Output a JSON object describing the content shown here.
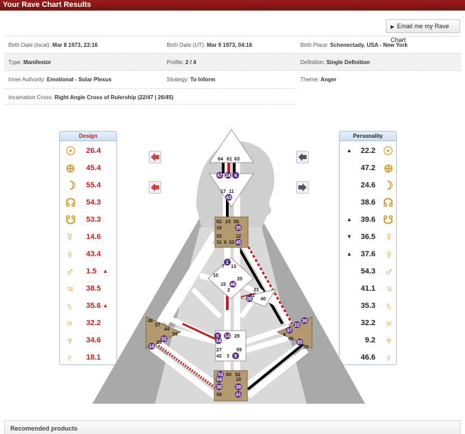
{
  "title_bar": "Your Rave Chart Results",
  "email_button": "Email me my Rave Chart",
  "info": {
    "birth_date_local_label": "Birth Date (local):",
    "birth_date_local": "Mar 8 1973, 23:16",
    "birth_date_utc_label": "Birth Date (UT):",
    "birth_date_utc": "Mar 9 1973, 04:16",
    "birth_place_label": "Birth Place:",
    "birth_place": "Schenectady, USA - New York",
    "type_label": "Type:",
    "type": "Manifestor",
    "profile_label": "Profile:",
    "profile": "2 / 4",
    "definition_label": "Definition:",
    "definition": "Single Definition",
    "authority_label": "Inner Authority:",
    "authority": "Emotional - Solar Plexus",
    "strategy_label": "Strategy:",
    "strategy": "To Inform",
    "theme_label": "Theme:",
    "theme": "Anger",
    "cross_label": "Incarnation Cross:",
    "cross": "Right Angle Cross of Rulership (22/47 | 26/45)"
  },
  "design": {
    "header": "Design",
    "rows": [
      {
        "icon": "sun-icon",
        "glyph": "☉",
        "value": "26.4",
        "mark": ""
      },
      {
        "icon": "earth-icon",
        "glyph": "⊕",
        "value": "45.4",
        "mark": ""
      },
      {
        "icon": "moon-icon",
        "glyph": "☽",
        "value": "55.4",
        "mark": ""
      },
      {
        "icon": "north-node-icon",
        "glyph": "☊",
        "value": "54.3",
        "mark": ""
      },
      {
        "icon": "south-node-icon",
        "glyph": "☋",
        "value": "53.3",
        "mark": ""
      },
      {
        "icon": "mercury-icon",
        "glyph": "☿",
        "value": "14.6",
        "mark": ""
      },
      {
        "icon": "venus-icon",
        "glyph": "♀",
        "value": "43.4",
        "mark": ""
      },
      {
        "icon": "mars-icon",
        "glyph": "♂",
        "value": "1.5",
        "mark": "▲"
      },
      {
        "icon": "jupiter-icon",
        "glyph": "♃",
        "value": "38.5",
        "mark": ""
      },
      {
        "icon": "saturn-icon",
        "glyph": "♄",
        "value": "35.6",
        "mark": "▲"
      },
      {
        "icon": "uranus-icon",
        "glyph": "♅",
        "value": "32.2",
        "mark": ""
      },
      {
        "icon": "neptune-icon",
        "glyph": "♆",
        "value": "34.6",
        "mark": ""
      },
      {
        "icon": "pluto-icon",
        "glyph": "♇",
        "value": "18.1",
        "mark": ""
      }
    ]
  },
  "personality": {
    "header": "Personality",
    "rows": [
      {
        "icon": "sun-icon",
        "glyph": "☉",
        "value": "22.2",
        "mark": "▲"
      },
      {
        "icon": "earth-icon",
        "glyph": "⊕",
        "value": "47.2",
        "mark": ""
      },
      {
        "icon": "moon-icon",
        "glyph": "☽",
        "value": "24.6",
        "mark": ""
      },
      {
        "icon": "north-node-icon",
        "glyph": "☊",
        "value": "38.6",
        "mark": ""
      },
      {
        "icon": "south-node-icon",
        "glyph": "☋",
        "value": "39.6",
        "mark": "▲"
      },
      {
        "icon": "mercury-icon",
        "glyph": "☿",
        "value": "36.5",
        "mark": "▼"
      },
      {
        "icon": "venus-icon",
        "glyph": "♀",
        "value": "37.6",
        "mark": "▲"
      },
      {
        "icon": "mars-icon",
        "glyph": "♂",
        "value": "54.3",
        "mark": ""
      },
      {
        "icon": "jupiter-icon",
        "glyph": "♃",
        "value": "41.1",
        "mark": ""
      },
      {
        "icon": "saturn-icon",
        "glyph": "♄",
        "value": "35.3",
        "mark": ""
      },
      {
        "icon": "uranus-icon",
        "glyph": "♅",
        "value": "32.2",
        "mark": ""
      },
      {
        "icon": "neptune-icon",
        "glyph": "♆",
        "value": "9.2",
        "mark": ""
      },
      {
        "icon": "pluto-icon",
        "glyph": "♇",
        "value": "46.6",
        "mark": ""
      }
    ]
  },
  "gates": {
    "head": [
      "64",
      "61",
      "63"
    ],
    "ajna_top": [
      "47",
      "24",
      "4"
    ],
    "ajna_bottom": [
      "17",
      "11",
      "43"
    ],
    "throat": [
      "62",
      "23",
      "56",
      "16",
      "35",
      "20",
      "12",
      "31",
      "8",
      "33",
      "45"
    ],
    "g": [
      "1",
      "7",
      "13",
      "10",
      "15",
      "46",
      "2",
      "25"
    ],
    "heart": [
      "21",
      "51",
      "26",
      "40"
    ],
    "spleen": [
      "48",
      "57",
      "44",
      "50",
      "32",
      "28",
      "18"
    ],
    "solar_plexus": [
      "36",
      "22",
      "37",
      "6",
      "49",
      "55",
      "30"
    ],
    "sacral": [
      "5",
      "14",
      "29",
      "34",
      "27",
      "59",
      "42",
      "3",
      "9"
    ],
    "root": [
      "53",
      "60",
      "52",
      "54",
      "19",
      "38",
      "39",
      "58",
      "41"
    ]
  },
  "colors": {
    "title_bar": "#8b1515",
    "design_red": "#c02020",
    "defined_center": "#b59a70",
    "gate_purple": "#5a2d8a",
    "glyph_gold": "#d4a23c"
  },
  "bottom": {
    "label": "Recomended products"
  }
}
